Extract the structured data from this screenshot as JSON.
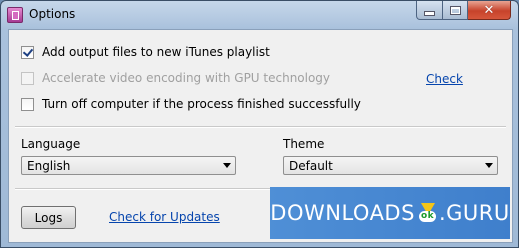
{
  "window": {
    "title": "Options"
  },
  "options": [
    {
      "label": "Add output files to new iTunes playlist",
      "checked": true,
      "disabled": false
    },
    {
      "label": "Accelerate video encoding with GPU technology",
      "checked": false,
      "disabled": true
    },
    {
      "label": "Turn off computer if the process finished successfully",
      "checked": false,
      "disabled": false
    }
  ],
  "check_link": "Check",
  "language": {
    "label": "Language",
    "value": "English"
  },
  "theme": {
    "label": "Theme",
    "value": "Default"
  },
  "logs_button": "Logs",
  "updates_link": "Check for Updates",
  "watermark": {
    "left": "DOWNLOADS",
    "right": ".GURU"
  },
  "colors": {
    "link": "#0645ad",
    "watermark_bg": "#4f8fd6"
  }
}
